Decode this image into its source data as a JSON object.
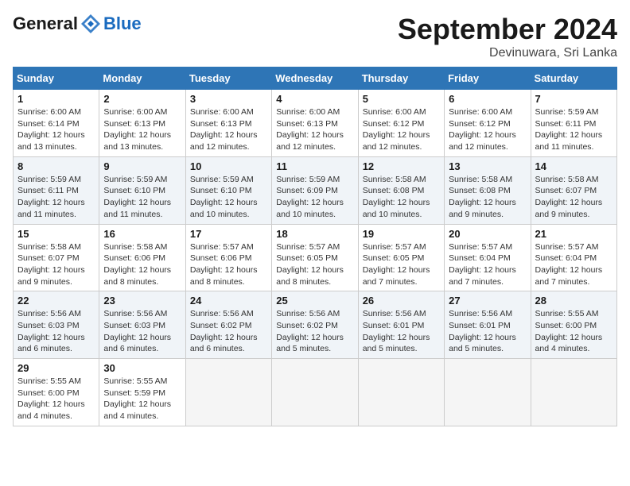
{
  "header": {
    "logo": {
      "part1": "General",
      "part2": "Blue"
    },
    "title": "September 2024",
    "location": "Devinuwara, Sri Lanka"
  },
  "weekdays": [
    "Sunday",
    "Monday",
    "Tuesday",
    "Wednesday",
    "Thursday",
    "Friday",
    "Saturday"
  ],
  "weeks": [
    [
      {
        "day": "1",
        "sunrise": "6:00 AM",
        "sunset": "6:14 PM",
        "daylight": "12 hours and 13 minutes."
      },
      {
        "day": "2",
        "sunrise": "6:00 AM",
        "sunset": "6:13 PM",
        "daylight": "12 hours and 13 minutes."
      },
      {
        "day": "3",
        "sunrise": "6:00 AM",
        "sunset": "6:13 PM",
        "daylight": "12 hours and 12 minutes."
      },
      {
        "day": "4",
        "sunrise": "6:00 AM",
        "sunset": "6:13 PM",
        "daylight": "12 hours and 12 minutes."
      },
      {
        "day": "5",
        "sunrise": "6:00 AM",
        "sunset": "6:12 PM",
        "daylight": "12 hours and 12 minutes."
      },
      {
        "day": "6",
        "sunrise": "6:00 AM",
        "sunset": "6:12 PM",
        "daylight": "12 hours and 12 minutes."
      },
      {
        "day": "7",
        "sunrise": "5:59 AM",
        "sunset": "6:11 PM",
        "daylight": "12 hours and 11 minutes."
      }
    ],
    [
      {
        "day": "8",
        "sunrise": "5:59 AM",
        "sunset": "6:11 PM",
        "daylight": "12 hours and 11 minutes."
      },
      {
        "day": "9",
        "sunrise": "5:59 AM",
        "sunset": "6:10 PM",
        "daylight": "12 hours and 11 minutes."
      },
      {
        "day": "10",
        "sunrise": "5:59 AM",
        "sunset": "6:10 PM",
        "daylight": "12 hours and 10 minutes."
      },
      {
        "day": "11",
        "sunrise": "5:59 AM",
        "sunset": "6:09 PM",
        "daylight": "12 hours and 10 minutes."
      },
      {
        "day": "12",
        "sunrise": "5:58 AM",
        "sunset": "6:08 PM",
        "daylight": "12 hours and 10 minutes."
      },
      {
        "day": "13",
        "sunrise": "5:58 AM",
        "sunset": "6:08 PM",
        "daylight": "12 hours and 9 minutes."
      },
      {
        "day": "14",
        "sunrise": "5:58 AM",
        "sunset": "6:07 PM",
        "daylight": "12 hours and 9 minutes."
      }
    ],
    [
      {
        "day": "15",
        "sunrise": "5:58 AM",
        "sunset": "6:07 PM",
        "daylight": "12 hours and 9 minutes."
      },
      {
        "day": "16",
        "sunrise": "5:58 AM",
        "sunset": "6:06 PM",
        "daylight": "12 hours and 8 minutes."
      },
      {
        "day": "17",
        "sunrise": "5:57 AM",
        "sunset": "6:06 PM",
        "daylight": "12 hours and 8 minutes."
      },
      {
        "day": "18",
        "sunrise": "5:57 AM",
        "sunset": "6:05 PM",
        "daylight": "12 hours and 8 minutes."
      },
      {
        "day": "19",
        "sunrise": "5:57 AM",
        "sunset": "6:05 PM",
        "daylight": "12 hours and 7 minutes."
      },
      {
        "day": "20",
        "sunrise": "5:57 AM",
        "sunset": "6:04 PM",
        "daylight": "12 hours and 7 minutes."
      },
      {
        "day": "21",
        "sunrise": "5:57 AM",
        "sunset": "6:04 PM",
        "daylight": "12 hours and 7 minutes."
      }
    ],
    [
      {
        "day": "22",
        "sunrise": "5:56 AM",
        "sunset": "6:03 PM",
        "daylight": "12 hours and 6 minutes."
      },
      {
        "day": "23",
        "sunrise": "5:56 AM",
        "sunset": "6:03 PM",
        "daylight": "12 hours and 6 minutes."
      },
      {
        "day": "24",
        "sunrise": "5:56 AM",
        "sunset": "6:02 PM",
        "daylight": "12 hours and 6 minutes."
      },
      {
        "day": "25",
        "sunrise": "5:56 AM",
        "sunset": "6:02 PM",
        "daylight": "12 hours and 5 minutes."
      },
      {
        "day": "26",
        "sunrise": "5:56 AM",
        "sunset": "6:01 PM",
        "daylight": "12 hours and 5 minutes."
      },
      {
        "day": "27",
        "sunrise": "5:56 AM",
        "sunset": "6:01 PM",
        "daylight": "12 hours and 5 minutes."
      },
      {
        "day": "28",
        "sunrise": "5:55 AM",
        "sunset": "6:00 PM",
        "daylight": "12 hours and 4 minutes."
      }
    ],
    [
      {
        "day": "29",
        "sunrise": "5:55 AM",
        "sunset": "6:00 PM",
        "daylight": "12 hours and 4 minutes."
      },
      {
        "day": "30",
        "sunrise": "5:55 AM",
        "sunset": "5:59 PM",
        "daylight": "12 hours and 4 minutes."
      },
      null,
      null,
      null,
      null,
      null
    ]
  ]
}
